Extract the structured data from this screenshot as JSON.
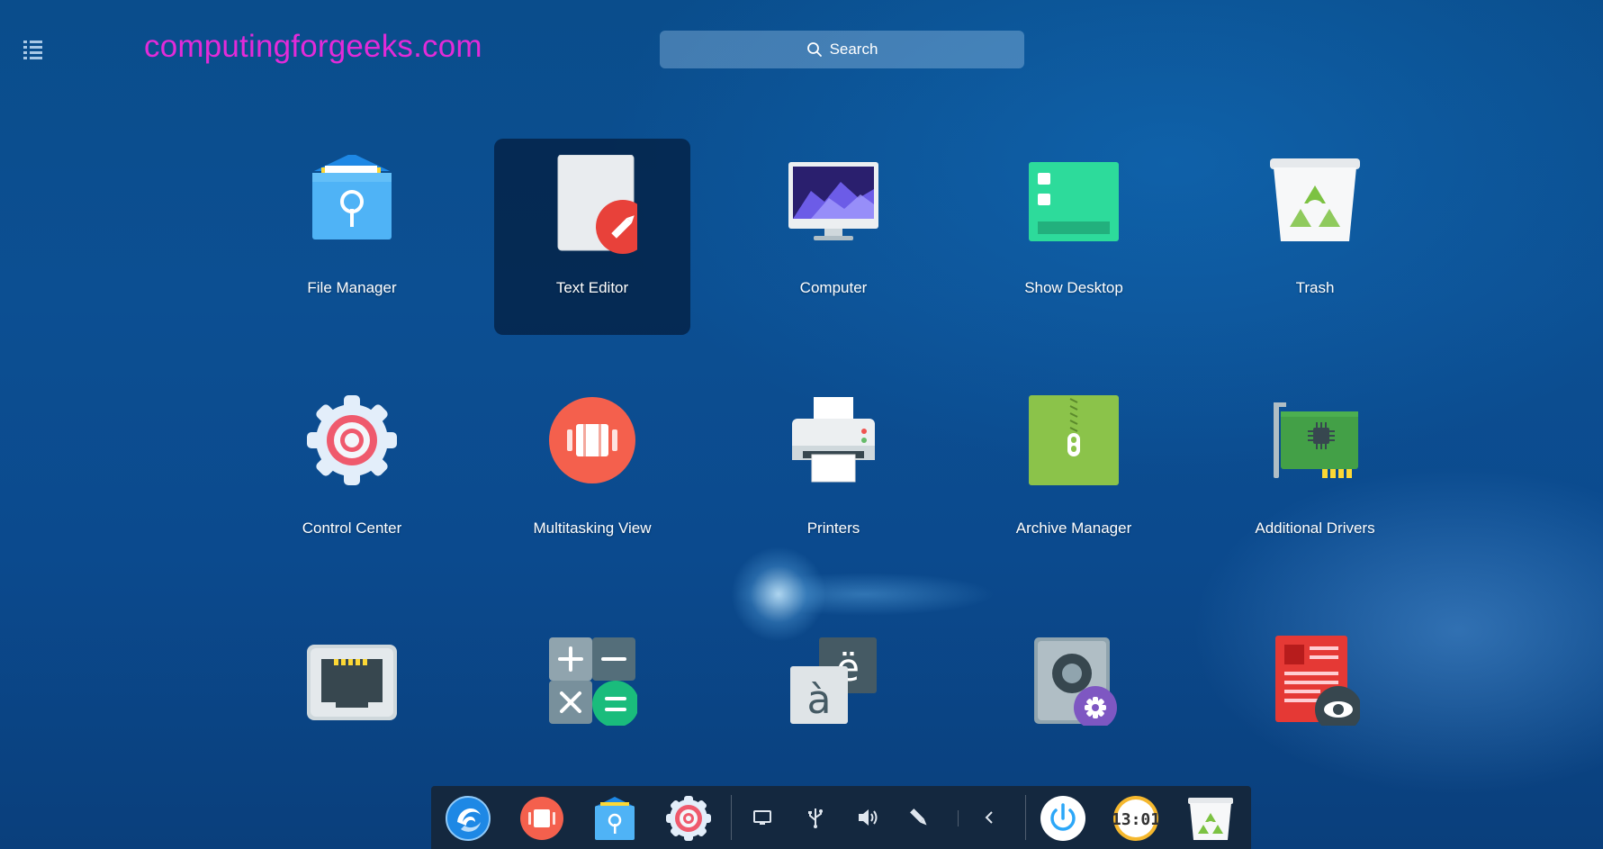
{
  "watermark": "computingforgeeks.com",
  "search": {
    "label": "Search"
  },
  "apps": [
    {
      "label": "File Manager",
      "icon": "folder-icon"
    },
    {
      "label": "Text Editor",
      "icon": "text-editor-icon",
      "selected": true
    },
    {
      "label": "Computer",
      "icon": "monitor-icon"
    },
    {
      "label": "Show Desktop",
      "icon": "show-desktop-icon"
    },
    {
      "label": "Trash",
      "icon": "trash-icon"
    },
    {
      "label": "Control Center",
      "icon": "gear-icon"
    },
    {
      "label": "Multitasking View",
      "icon": "multitasking-icon"
    },
    {
      "label": "Printers",
      "icon": "printer-icon"
    },
    {
      "label": "Archive Manager",
      "icon": "archive-icon"
    },
    {
      "label": "Additional Drivers",
      "icon": "driver-card-icon"
    },
    {
      "label": "",
      "icon": "network-port-icon"
    },
    {
      "label": "",
      "icon": "calculator-icon"
    },
    {
      "label": "",
      "icon": "font-icon"
    },
    {
      "label": "",
      "icon": "disk-settings-icon"
    },
    {
      "label": "",
      "icon": "document-viewer-icon"
    }
  ],
  "dock": {
    "launcher": "deepin-launcher-icon",
    "apps": [
      "multitasking-icon",
      "folder-icon",
      "gear-icon"
    ],
    "tray": [
      "monitor-tray-icon",
      "usb-icon",
      "volume-icon",
      "pen-icon",
      "chevron-left-icon"
    ],
    "right": [
      "power-icon",
      "clock-icon",
      "trash-icon"
    ],
    "clock_text": "13:01"
  },
  "colors": {
    "watermark": "#e22bd9",
    "selected_tile": "#031c3c",
    "accent_blue": "#2ca7f8",
    "accent_red": "#ef4b3c",
    "accent_green": "#2ddb9b"
  }
}
